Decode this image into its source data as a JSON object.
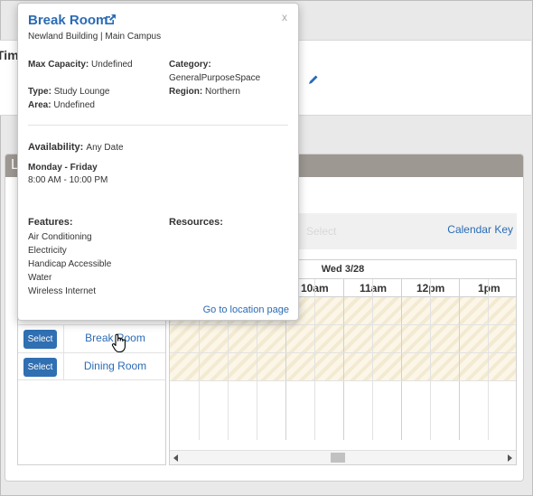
{
  "top": {
    "title_fragment": "Tim"
  },
  "panel": {
    "header_fragment": "L"
  },
  "toolbar": {
    "ghost_text": "Select",
    "calendar_key": "Calendar Key"
  },
  "rooms": [
    {
      "select_label": "Select",
      "name": "Break Room"
    },
    {
      "select_label": "Select",
      "name": "Dining Room"
    }
  ],
  "grid": {
    "date": "Wed 3/28",
    "hours": [
      "10am",
      "11am",
      "12pm",
      "1pm"
    ]
  },
  "popup": {
    "title": "Break Room",
    "close": "x",
    "subtitle": "Newland Building | Main Campus",
    "max_capacity_label": "Max Capacity:",
    "max_capacity_value": "Undefined",
    "category_label": "Category:",
    "category_value": "GeneralPurposeSpace",
    "type_label": "Type:",
    "type_value": "Study Lounge",
    "region_label": "Region:",
    "region_value": "Northern",
    "area_label": "Area:",
    "area_value": "Undefined",
    "availability_label": "Availability:",
    "availability_value": "Any Date",
    "days": "Monday - Friday",
    "hours": "8:00 AM - 10:00 PM",
    "features_label": "Features:",
    "features": [
      "Air Conditioning",
      "Electricity",
      "Handicap Accessible",
      "Water",
      "Wireless Internet"
    ],
    "resources_label": "Resources:",
    "goto_link": "Go to location page"
  },
  "colors": {
    "link": "#2a6bb5",
    "button": "#2f6fb2",
    "panel_header": "#9e9892"
  },
  "icons": [
    "external-link-icon",
    "pencil-icon",
    "hand-cursor-icon",
    "scroll-left-icon",
    "scroll-right-icon"
  ]
}
